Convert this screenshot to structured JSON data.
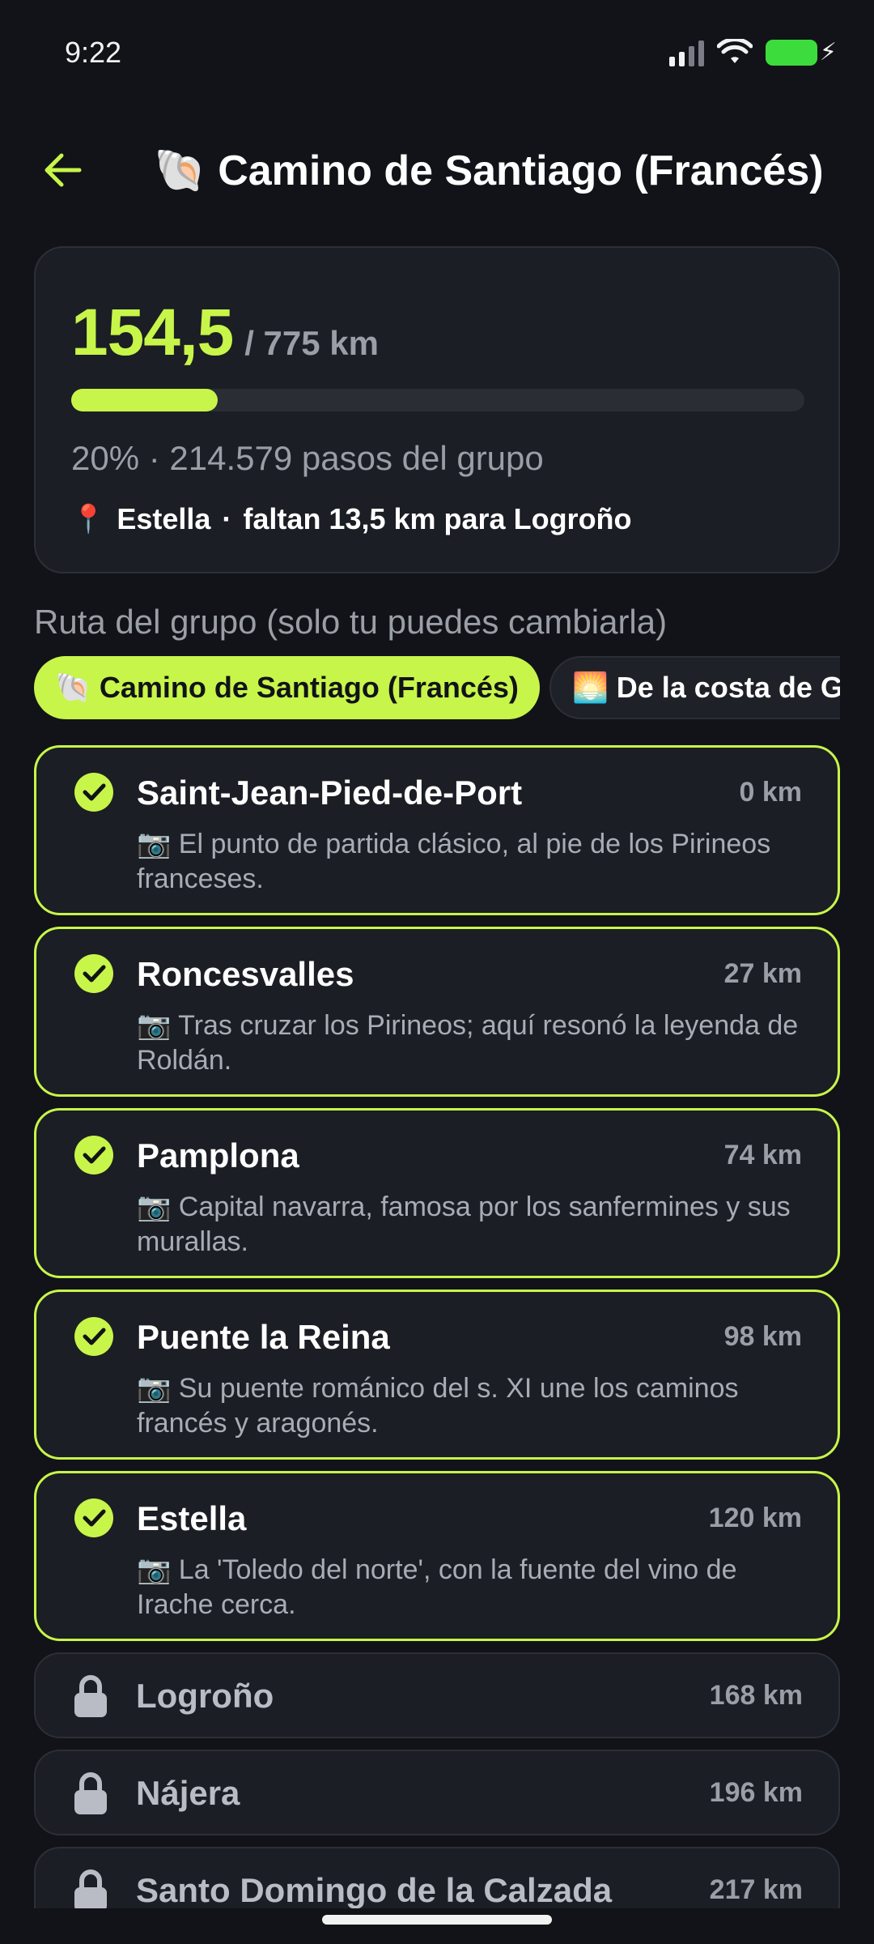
{
  "status_bar": {
    "time": "9:22"
  },
  "header": {
    "title": "🐚 Camino de Santiago (Francés)"
  },
  "progress": {
    "km_done": "154,5",
    "km_total": "/ 775 km",
    "fraction": 0.2,
    "percent_text": "20% · 214.579 pasos del grupo",
    "location": "Estella",
    "separator": "·",
    "remaining": "faltan 13,5 km para Logroño"
  },
  "route_section": {
    "heading": "Ruta del grupo (solo tu puedes cambiarla)",
    "chips": [
      {
        "label": "🐚 Camino de Santiago (Francés)",
        "active": true
      },
      {
        "label": "🌅 De la costa de Gra",
        "active": false
      }
    ]
  },
  "stops": [
    {
      "name": "Saint-Jean-Pied-de-Port",
      "km": "0 km",
      "desc": "📷 El punto de partida clásico, al pie de los Pirineos franceses.",
      "status": "done"
    },
    {
      "name": "Roncesvalles",
      "km": "27 km",
      "desc": "📷 Tras cruzar los Pirineos; aquí resonó la leyenda de Roldán.",
      "status": "done"
    },
    {
      "name": "Pamplona",
      "km": "74 km",
      "desc": "📷 Capital navarra, famosa por los sanfermines y sus murallas.",
      "status": "done"
    },
    {
      "name": "Puente la Reina",
      "km": "98 km",
      "desc": "📷 Su puente románico del s. XI une los caminos francés y aragonés.",
      "status": "done"
    },
    {
      "name": "Estella",
      "km": "120 km",
      "desc": "📷 La 'Toledo del norte', con la fuente del vino de Irache cerca.",
      "status": "done"
    },
    {
      "name": "Logroño",
      "km": "168 km",
      "status": "locked"
    },
    {
      "name": "Nájera",
      "km": "196 km",
      "status": "locked"
    },
    {
      "name": "Santo Domingo de la Calzada",
      "km": "217 km",
      "status": "locked"
    }
  ],
  "colors": {
    "accent": "#c8f54a",
    "background": "#111318",
    "card": "#1b1e24",
    "muted": "#9a9ea6"
  }
}
